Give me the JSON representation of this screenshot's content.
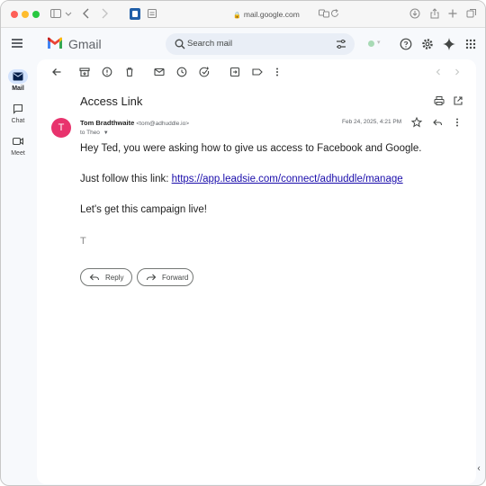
{
  "browser": {
    "url": "mail.google.com"
  },
  "header": {
    "app_name": "Gmail",
    "search_placeholder": "Search mail"
  },
  "rail": {
    "items": [
      {
        "label": "Mail",
        "icon": "mail-icon",
        "active": true
      },
      {
        "label": "Chat",
        "icon": "chat-icon",
        "active": false
      },
      {
        "label": "Meet",
        "icon": "meet-icon",
        "active": false
      }
    ]
  },
  "email": {
    "subject": "Access Link",
    "avatar_letter": "T",
    "sender_name": "Tom Bradthwaite",
    "sender_email": "<tom@adhuddle.io>",
    "recipient": "to Theo",
    "date": "Feb 24, 2025, 4:21 PM",
    "body": {
      "line1": "Hey Ted, you were asking how to give us access to Facebook and Google.",
      "line2_prefix": "Just follow this link: ",
      "link": "https://app.leadsie.com/connect/adhuddle/manage",
      "line3": "Let's get this campaign live!",
      "signature": "T"
    }
  },
  "actions": {
    "reply": "Reply",
    "forward": "Forward"
  },
  "colors": {
    "avatar": "#e8336d",
    "link": "#1a0dab",
    "rail_active": "#d3e3fd",
    "search_bg": "#e9eef6"
  }
}
